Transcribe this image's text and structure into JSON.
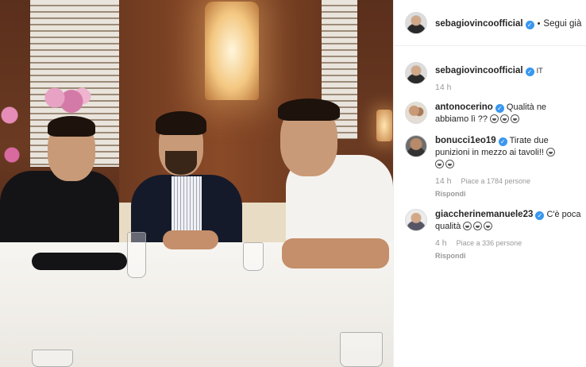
{
  "header": {
    "username": "sebagiovincoofficial",
    "separator": "•",
    "follow_label": "Segui già"
  },
  "caption": {
    "username": "sebagiovincoofficial",
    "text": "IT",
    "time": "14 h"
  },
  "comments": [
    {
      "username": "antonocerino",
      "text": "Qualità ne abbiamo lì ??",
      "emoji_count": 3
    },
    {
      "username": "bonucci1eo19",
      "text": "Tirate due punizioni in mezzo ai tavoli!!",
      "emoji_count": 3,
      "time": "14 h",
      "likes": "Piace a 1784 persone",
      "reply": "Rispondi"
    },
    {
      "username": "giaccherinemanuele23",
      "text": "C'è poca qualità",
      "emoji_count": 3,
      "time": "4 h",
      "likes": "Piace a 336 persone",
      "reply": "Rispondi"
    }
  ],
  "colors": {
    "verified": "#3897f0",
    "text": "#262626",
    "muted": "#999999",
    "divider": "#efefef"
  },
  "icons": {
    "verified": "verified-badge-icon",
    "emoji": "laughing-emoji-icon"
  }
}
